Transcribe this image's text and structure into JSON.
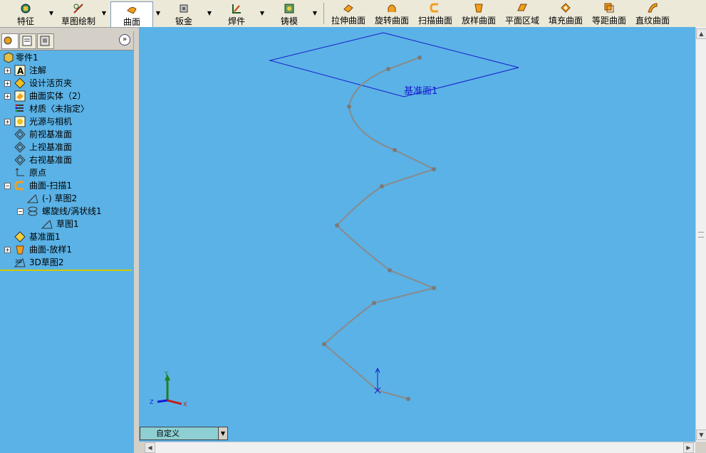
{
  "tabs": [
    {
      "label": "特征"
    },
    {
      "label": "草图绘制"
    },
    {
      "label": "曲面"
    },
    {
      "label": "钣金"
    },
    {
      "label": "焊件"
    },
    {
      "label": "铸模"
    }
  ],
  "tools": [
    {
      "label": "拉伸曲面",
      "icon": "extruded-surface-icon"
    },
    {
      "label": "旋转曲面",
      "icon": "revolved-surface-icon"
    },
    {
      "label": "扫描曲面",
      "icon": "swept-surface-icon"
    },
    {
      "label": "放样曲面",
      "icon": "lofted-surface-icon"
    },
    {
      "label": "平面区域",
      "icon": "planar-surface-icon"
    },
    {
      "label": "填充曲面",
      "icon": "filled-surface-icon"
    },
    {
      "label": "等距曲面",
      "icon": "offset-surface-icon"
    },
    {
      "label": "直纹曲面",
      "icon": "ruled-surface-icon"
    }
  ],
  "tree": {
    "root": "零件1",
    "items": [
      {
        "label": "注解"
      },
      {
        "label": "设计活页夹"
      },
      {
        "label": "曲面实体（2）"
      },
      {
        "label": "材质〈未指定〉"
      },
      {
        "label": "光源与相机"
      },
      {
        "label": "前视基准面"
      },
      {
        "label": "上视基准面"
      },
      {
        "label": "右视基准面"
      },
      {
        "label": "原点"
      },
      {
        "label": "曲面-扫描1"
      },
      {
        "label": "(-) 草图2"
      },
      {
        "label": "螺旋线/涡状线1"
      },
      {
        "label": "草图1"
      },
      {
        "label": "基准面1"
      },
      {
        "label": "曲面-放样1"
      },
      {
        "label": "3D草图2"
      }
    ]
  },
  "viewport": {
    "plane_label": "基准面1",
    "triad": {
      "x": "X",
      "y": "Y",
      "z": "Z"
    }
  },
  "view_selector": {
    "value": "自定义"
  },
  "colors": {
    "background": "#5ab2e6",
    "plane": "#1a1acd",
    "helix": "#8a8a8a"
  }
}
